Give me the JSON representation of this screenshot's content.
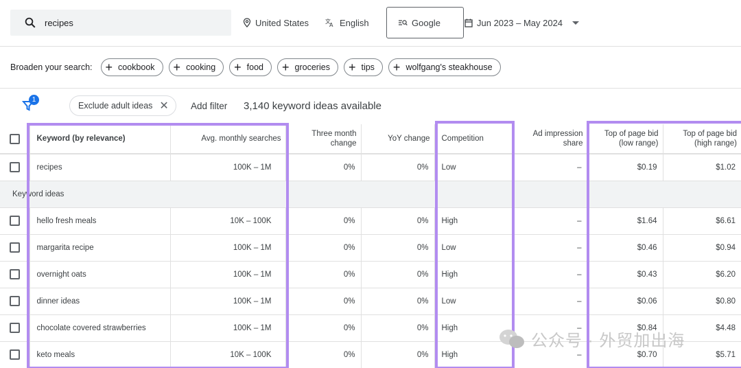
{
  "search": {
    "query": "recipes"
  },
  "toolbar": {
    "location": "United States",
    "language": "English",
    "engine": "Google",
    "date_range": "Jun 2023 – May 2024"
  },
  "broaden": {
    "label": "Broaden your search:",
    "chips": [
      "cookbook",
      "cooking",
      "food",
      "groceries",
      "tips",
      "wolfgang's steakhouse"
    ]
  },
  "filters": {
    "badge_count": "1",
    "exclude_chip": "Exclude adult ideas",
    "add_filter": "Add filter",
    "ideas_count": "3,140 keyword ideas available"
  },
  "table": {
    "headers": {
      "keyword": "Keyword (by relevance)",
      "avg_searches": "Avg. monthly searches",
      "three_month_1": "Three month",
      "three_month_2": "change",
      "yoy": "YoY change",
      "competition": "Competition",
      "ad_share_1": "Ad impression",
      "ad_share_2": "share",
      "bid_low_1": "Top of page bid",
      "bid_low_2": "(low range)",
      "bid_high_1": "Top of page bid",
      "bid_high_2": "(high range)"
    },
    "searched_row": {
      "keyword": "recipes",
      "avg": "100K – 1M",
      "three": "0%",
      "yoy": "0%",
      "comp": "Low",
      "share": "–",
      "low": "$0.19",
      "high": "$1.02"
    },
    "section_label": "Keyword ideas",
    "rows": [
      {
        "keyword": "hello fresh meals",
        "avg": "10K – 100K",
        "three": "0%",
        "yoy": "0%",
        "comp": "High",
        "share": "–",
        "low": "$1.64",
        "high": "$6.61"
      },
      {
        "keyword": "margarita recipe",
        "avg": "100K – 1M",
        "three": "0%",
        "yoy": "0%",
        "comp": "Low",
        "share": "–",
        "low": "$0.46",
        "high": "$0.94"
      },
      {
        "keyword": "overnight oats",
        "avg": "100K – 1M",
        "three": "0%",
        "yoy": "0%",
        "comp": "High",
        "share": "–",
        "low": "$0.43",
        "high": "$6.20"
      },
      {
        "keyword": "dinner ideas",
        "avg": "100K – 1M",
        "three": "0%",
        "yoy": "0%",
        "comp": "Low",
        "share": "–",
        "low": "$0.06",
        "high": "$0.80"
      },
      {
        "keyword": "chocolate covered strawberries",
        "avg": "100K – 1M",
        "three": "0%",
        "yoy": "0%",
        "comp": "High",
        "share": "–",
        "low": "$0.84",
        "high": "$4.48"
      },
      {
        "keyword": "keto meals",
        "avg": "10K – 100K",
        "three": "0%",
        "yoy": "0%",
        "comp": "High",
        "share": "–",
        "low": "$0.70",
        "high": "$5.71"
      }
    ]
  },
  "watermark": {
    "text": "公众号 · 外贸加出海"
  },
  "colors": {
    "highlight": "#b28cf0",
    "accent": "#1a73e8"
  }
}
